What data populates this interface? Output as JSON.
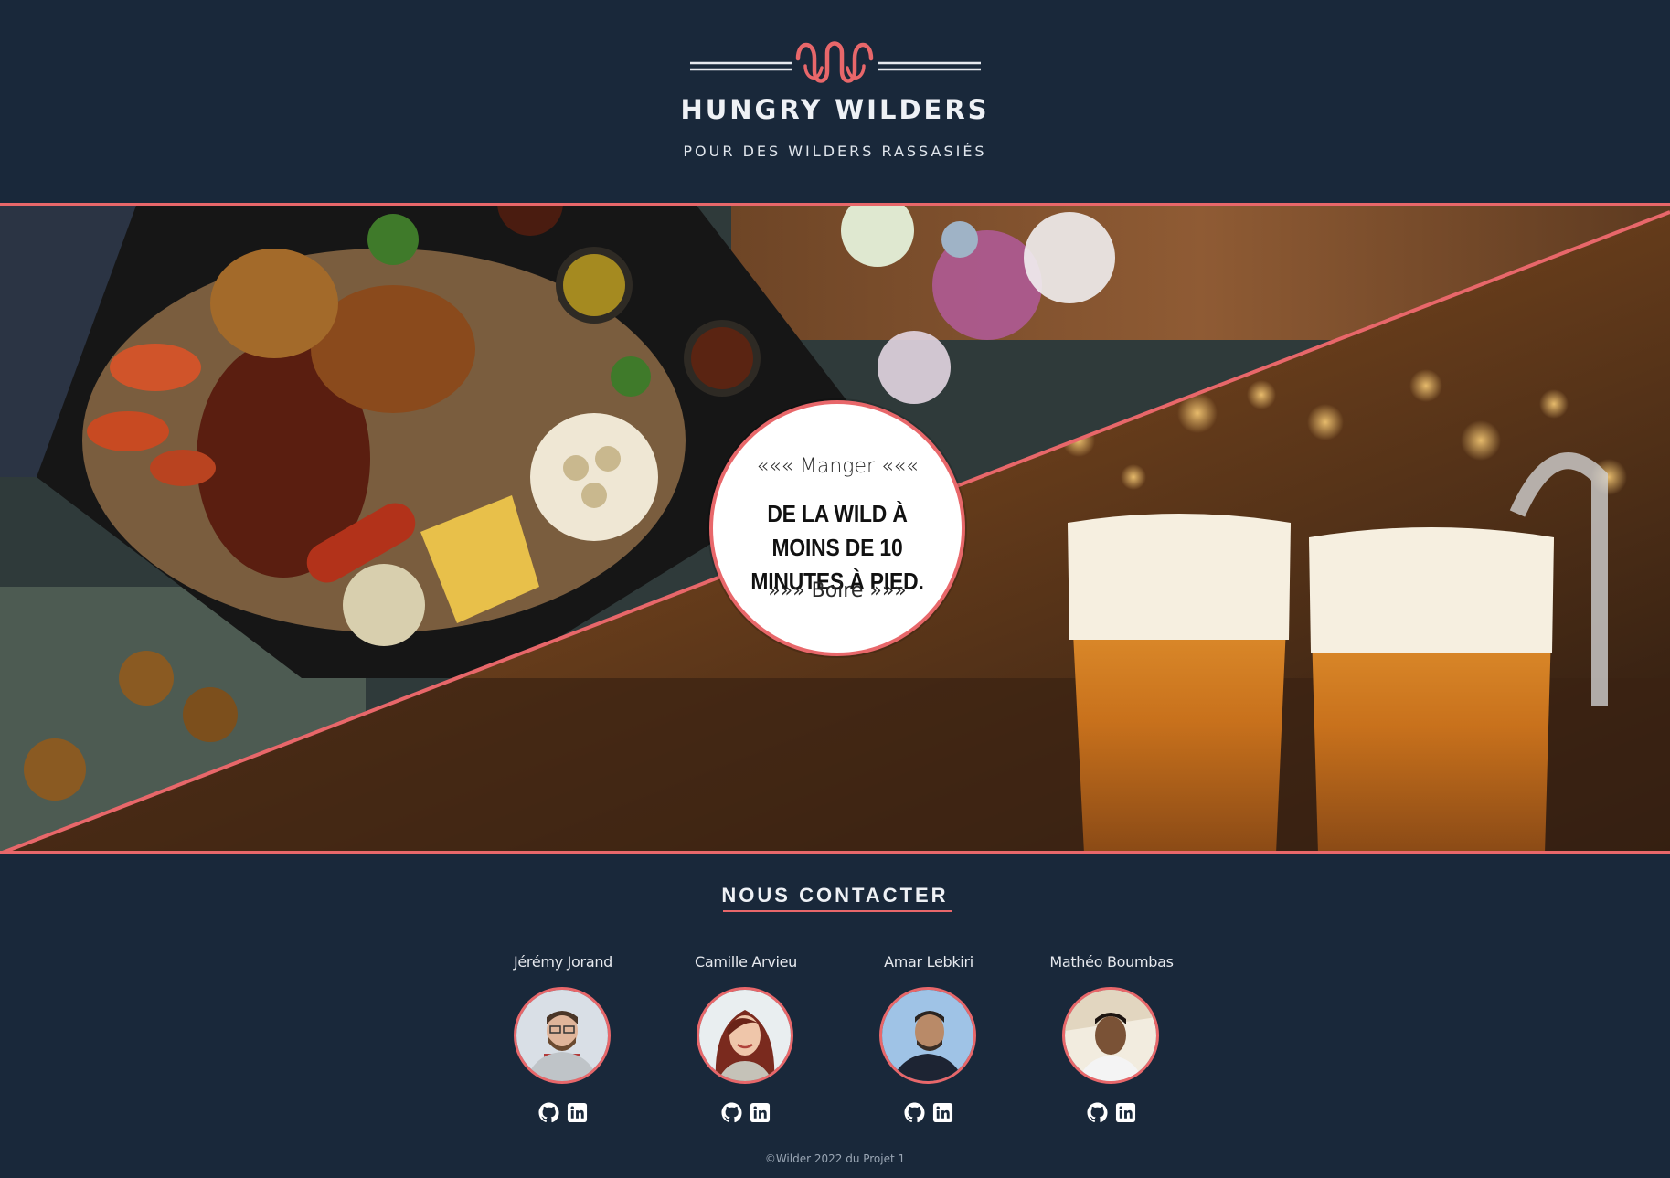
{
  "header": {
    "brand": "HUNGRY WILDERS",
    "tagline": "POUR DES WILDERS RASSASIÉS",
    "logo_icon": "wave-w-logo-icon"
  },
  "hero": {
    "top_text": "««« Manger «««",
    "main_text": "DE LA WILD À MOINS DE 10 MINUTES À PIED.",
    "bottom_text": "»»» Boire »»»",
    "left_image": "grilled-food-platter",
    "right_image": "beer-glasses-bar"
  },
  "contact": {
    "title": "NOUS CONTACTER",
    "members": [
      {
        "name": "Jérémy Jorand"
      },
      {
        "name": "Camille Arvieu"
      },
      {
        "name": "Amar Lebkiri"
      },
      {
        "name": "Mathéo Boumbas"
      }
    ]
  },
  "footer": {
    "text": "©Wilder 2022 du Projet 1"
  },
  "colors": {
    "background": "#19283a",
    "accent": "#e8676a",
    "text": "#eef1f5"
  }
}
